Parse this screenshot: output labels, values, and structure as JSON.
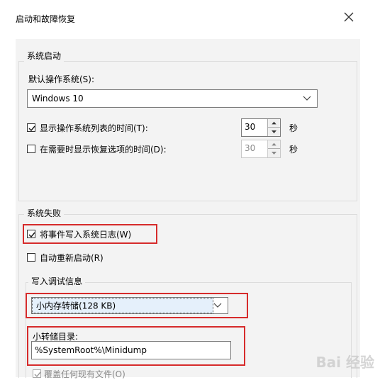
{
  "window": {
    "title": "启动和故障恢复"
  },
  "system_startup": {
    "group_label": "系统启动",
    "default_os_label": "默认操作系统(S):",
    "default_os_value": "Windows 10",
    "show_os_list": {
      "checked": true,
      "label": "显示操作系统列表的时间(T):",
      "value": "30",
      "unit": "秒"
    },
    "show_recovery": {
      "checked": false,
      "label": "在需要时显示恢复选项的时间(D):",
      "value": "30",
      "unit": "秒"
    }
  },
  "system_failure": {
    "group_label": "系统失败",
    "write_event_log": {
      "checked": true,
      "label": "将事件写入系统日志(W)"
    },
    "auto_restart": {
      "checked": false,
      "label": "自动重新启动(R)"
    },
    "debug_info_label": "写入调试信息",
    "debug_info_value": "小内存转储(128 KB)",
    "small_dump_dir_label": "小转储目录:",
    "small_dump_dir_value": "%SystemRoot%\\Minidump",
    "overwrite_label": "覆盖任何现有文件(O)"
  },
  "watermark": {
    "text": "Bai 经验"
  },
  "colors": {
    "highlight": "#d62b2b"
  }
}
